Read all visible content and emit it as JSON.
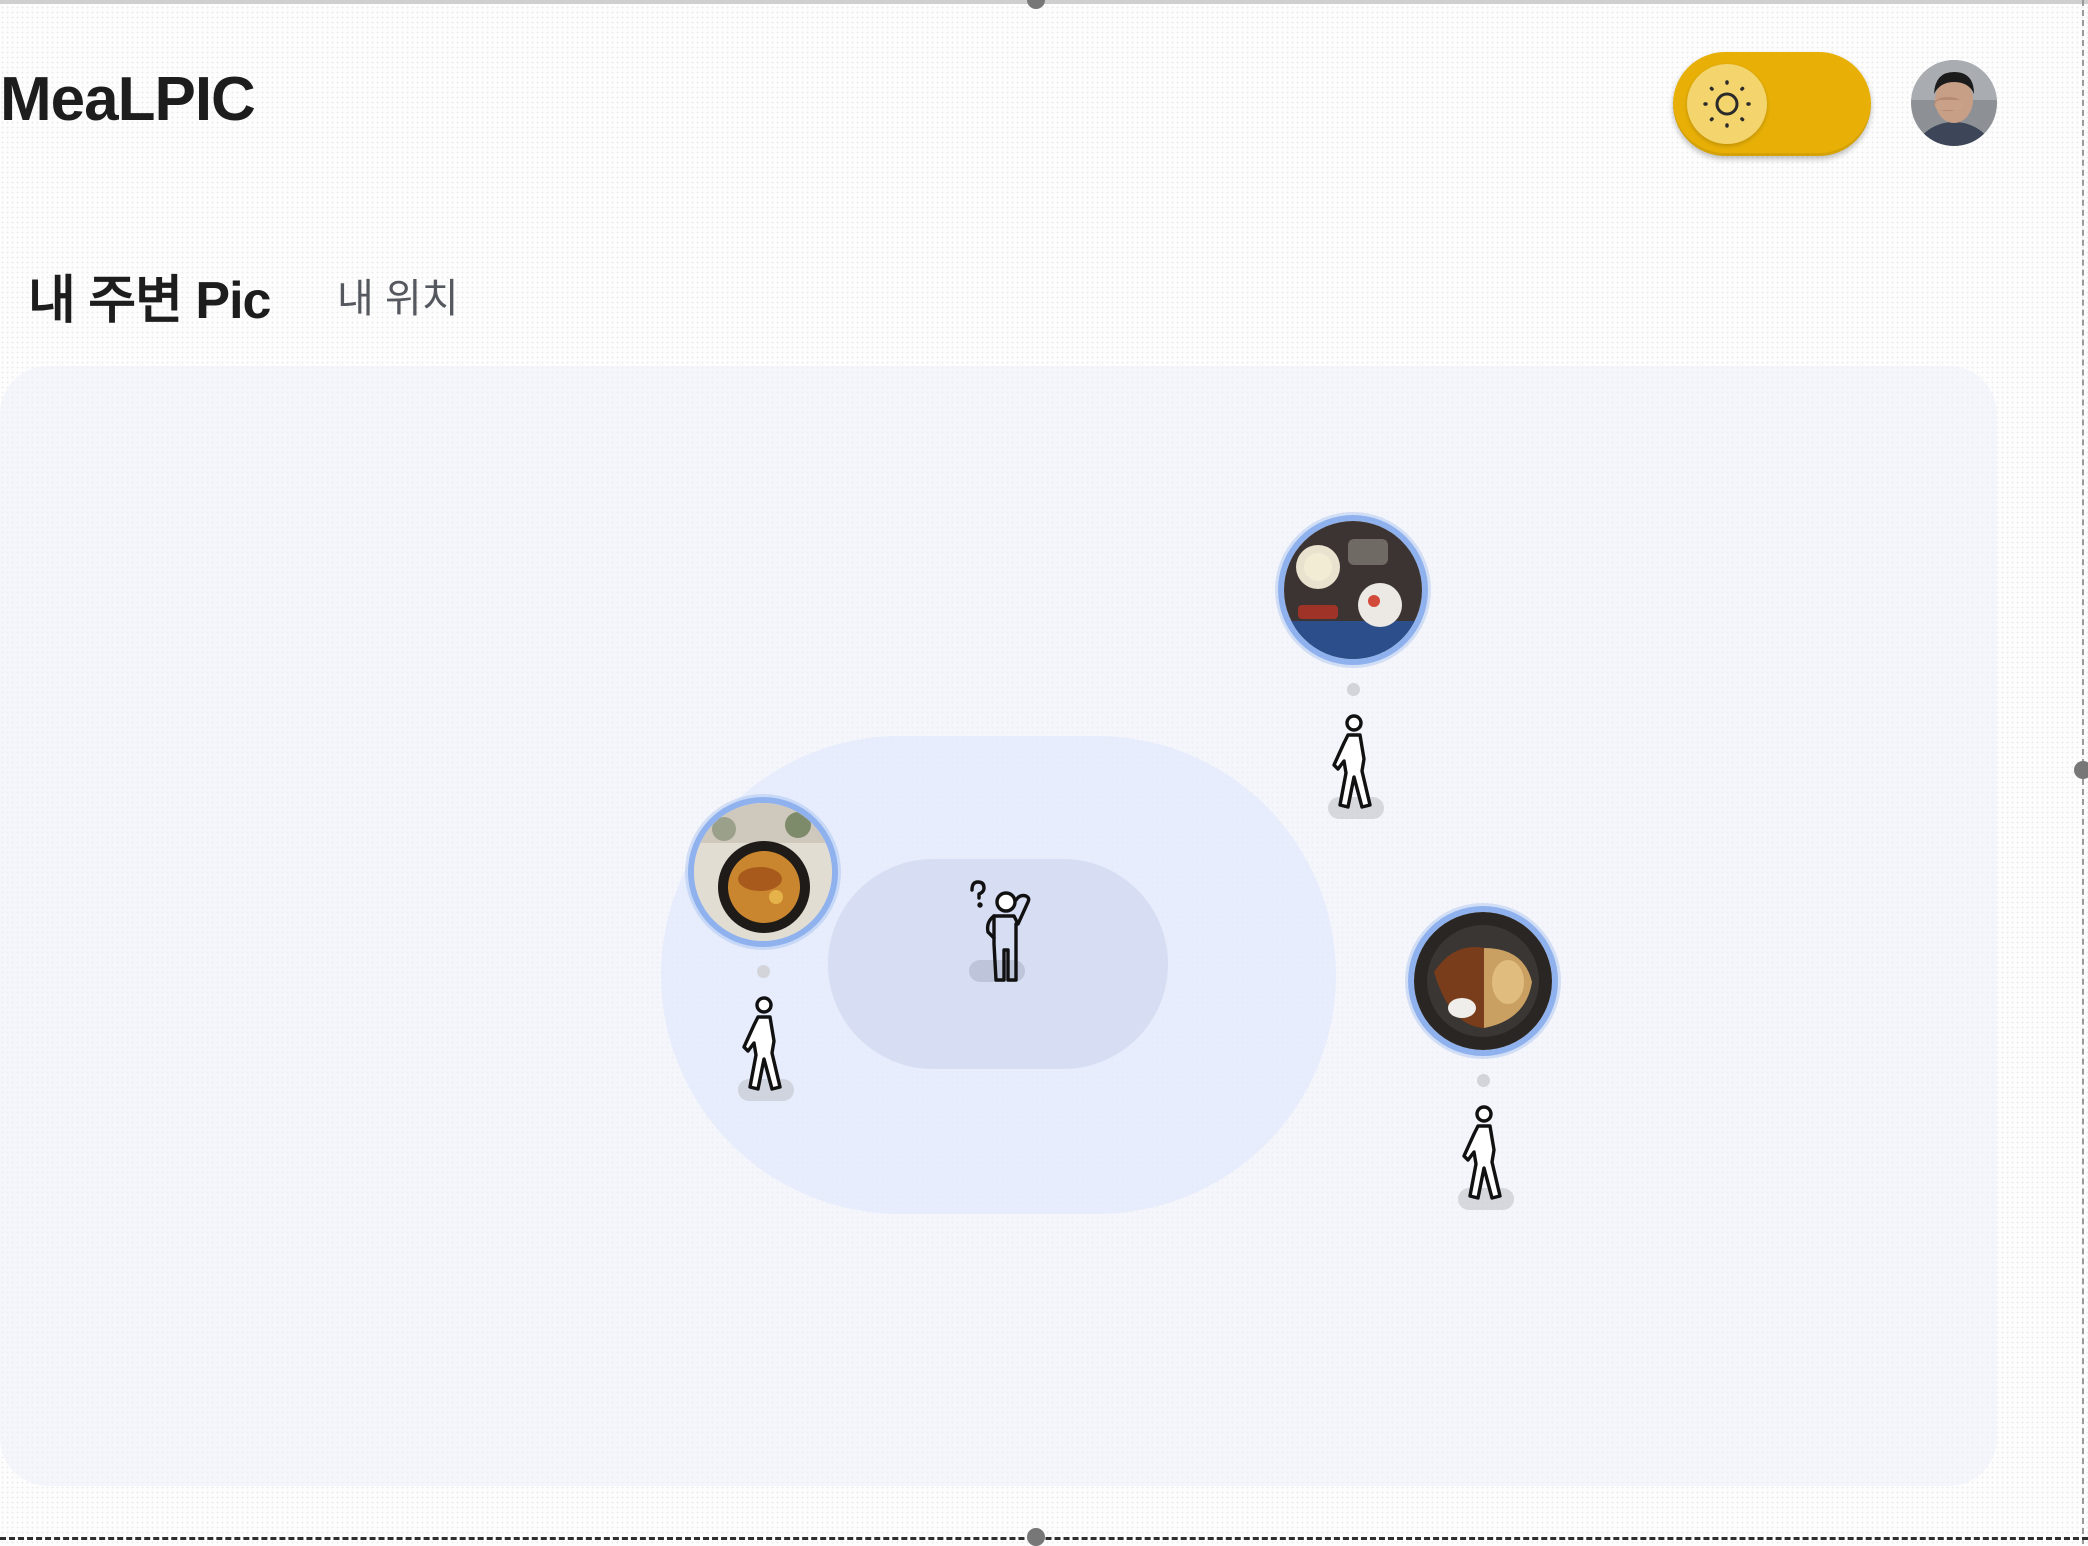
{
  "header": {
    "app_title": "MeaLPIC",
    "theme_toggle": {
      "state": "light",
      "icon": "sun-icon",
      "color": "#e8b007"
    },
    "avatar": {
      "icon": "user-avatar"
    }
  },
  "section": {
    "title": "내 주변 Pic",
    "subtitle": "내 위치"
  },
  "map": {
    "center_marker": {
      "icon": "confused-person-icon"
    },
    "pics": [
      {
        "name": "pic-marker-left",
        "photo": "rice-bowl-photo",
        "walker_icon": "walking-person-icon"
      },
      {
        "name": "pic-marker-top-right",
        "photo": "table-meal-photo",
        "walker_icon": "walking-person-icon"
      },
      {
        "name": "pic-marker-right",
        "photo": "rice-curry-photo",
        "walker_icon": "walking-person-icon"
      }
    ],
    "accent_color": "#8fb2ee"
  }
}
